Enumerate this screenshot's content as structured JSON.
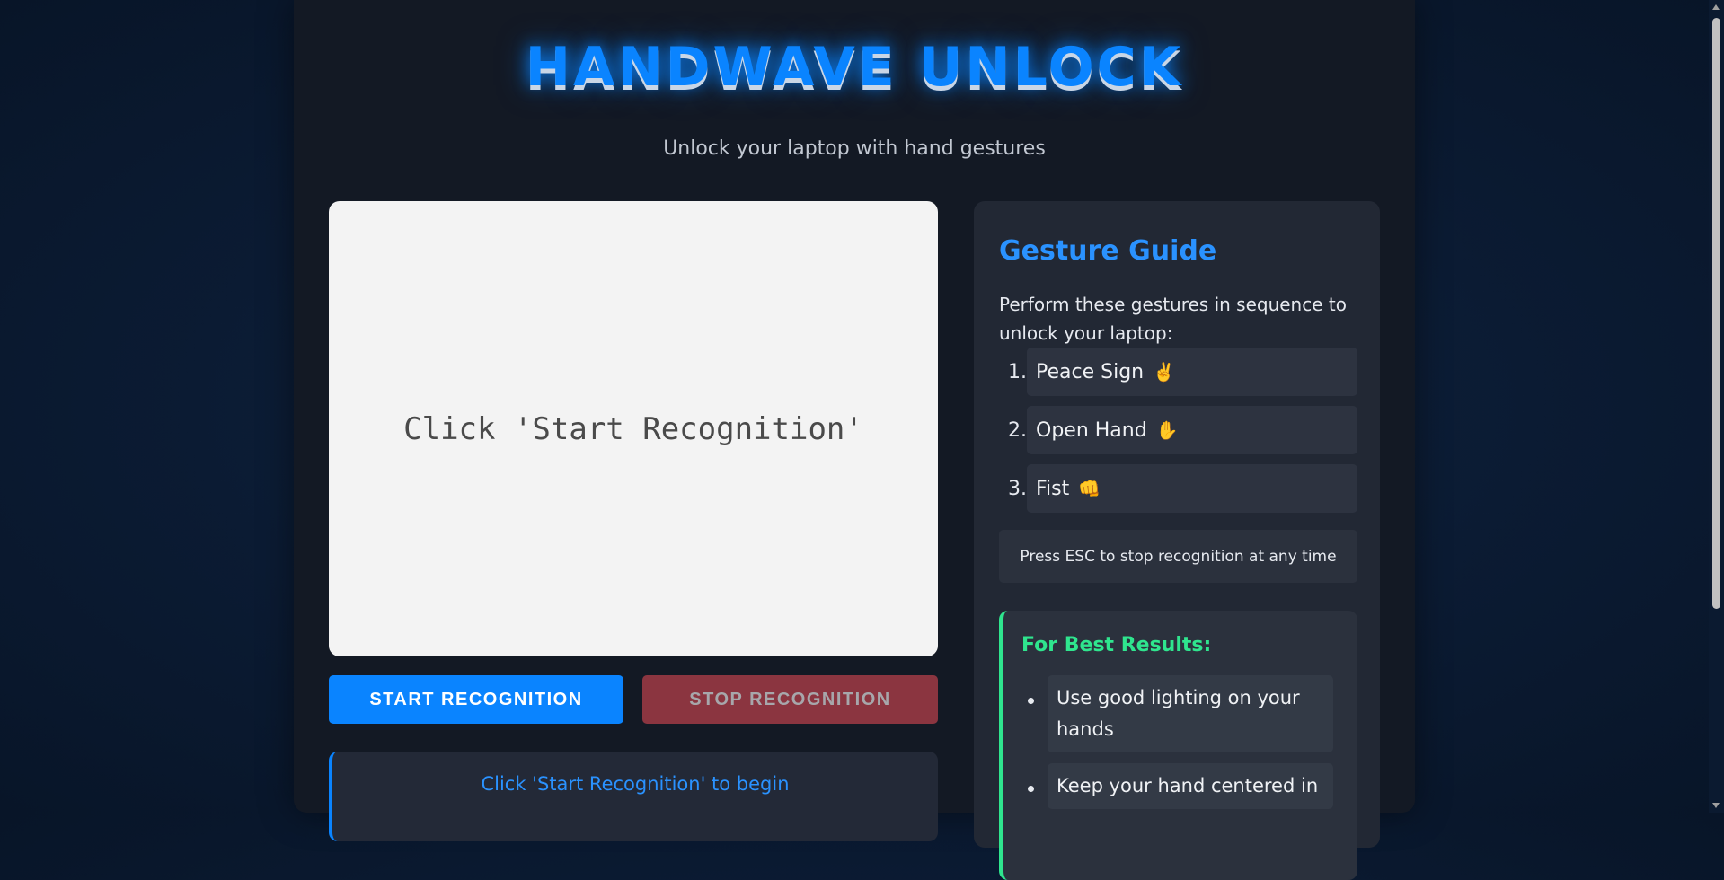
{
  "header": {
    "title": "HANDWAVE UNLOCK",
    "subtitle": "Unlock your laptop with hand gestures"
  },
  "video": {
    "placeholder_text": "Click 'Start Recognition'"
  },
  "controls": {
    "start_label": "START RECOGNITION",
    "stop_label": "STOP RECOGNITION"
  },
  "status": {
    "message": "Click 'Start Recognition' to begin"
  },
  "guide": {
    "title": "Gesture Guide",
    "intro": "Perform these gestures in sequence to unlock your laptop:",
    "steps": [
      {
        "number": "1.",
        "label": "Peace Sign",
        "emoji": "✌️"
      },
      {
        "number": "2.",
        "label": "Open Hand",
        "emoji": "✋"
      },
      {
        "number": "3.",
        "label": "Fist",
        "emoji": "👊"
      }
    ],
    "esc_note": "Press ESC to stop recognition at any time",
    "tips": {
      "title": "For Best Results:",
      "items": [
        "Use good lighting on your hands",
        "Keep your hand centered in"
      ]
    }
  },
  "colors": {
    "accent": "#0a84ff",
    "tips_accent": "#2fe58e",
    "stop_button": "#8b3540"
  }
}
